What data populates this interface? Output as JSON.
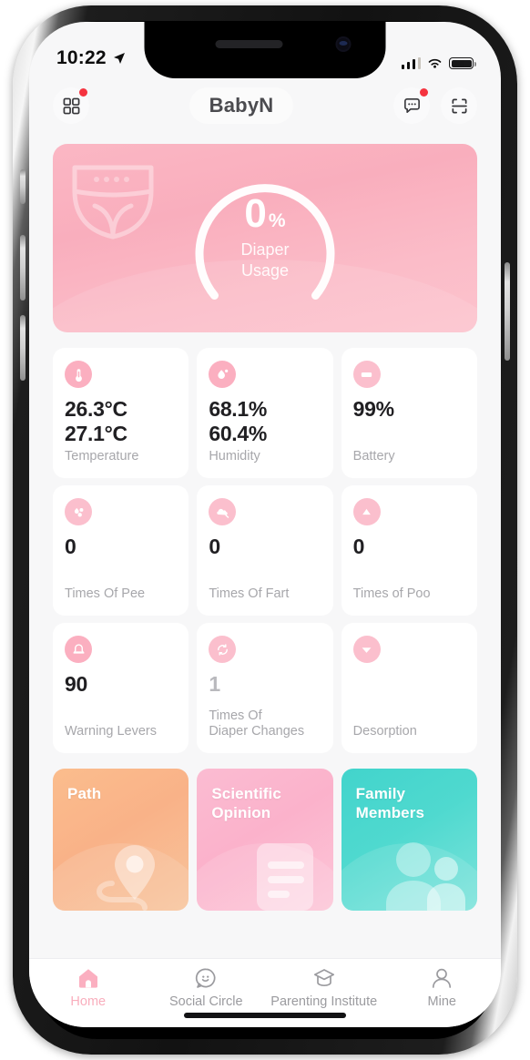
{
  "status_bar": {
    "time": "10:22",
    "location_icon": "location-arrow-icon",
    "signal_icon": "cellular-signal-icon",
    "wifi_icon": "wifi-icon",
    "battery_icon": "battery-full-icon"
  },
  "header": {
    "grid_button": "grid-menu-icon",
    "title": "BabyN",
    "chat_button": "chat-bubble-icon",
    "scan_button": "scan-frame-icon",
    "has_grid_badge": true,
    "has_chat_badge": true
  },
  "hero": {
    "watermark_icon": "diaper-icon",
    "value": "0",
    "unit": "%",
    "label_line1": "Diaper",
    "label_line2": "Usage",
    "gauge_percent": 0,
    "accent": "#f9aebd"
  },
  "metrics": [
    {
      "icon": "thermometer-icon",
      "value": "26.3°C\n27.1°C",
      "value_line1": "26.3°C",
      "value_line2": "27.1°C",
      "label": "Temperature",
      "muted": false
    },
    {
      "icon": "humidity-drop-icon",
      "value": "68.1%\n60.4%",
      "value_line1": "68.1%",
      "value_line2": "60.4%",
      "label": "Humidity",
      "muted": false
    },
    {
      "icon": "battery-icon",
      "value": "99%",
      "value_line1": "99%",
      "value_line2": "",
      "label": "Battery",
      "muted": false
    },
    {
      "icon": "pee-drops-icon",
      "value": "0",
      "value_line1": "0",
      "value_line2": "",
      "label": "Times Of Pee",
      "muted": false
    },
    {
      "icon": "fart-cloud-icon",
      "value": "0",
      "value_line1": "0",
      "value_line2": "",
      "label": "Times Of Fart",
      "muted": false
    },
    {
      "icon": "poo-icon",
      "value": "0",
      "value_line1": "0",
      "value_line2": "",
      "label": "Times of Poo",
      "muted": false
    },
    {
      "icon": "bell-alert-icon",
      "value": "90",
      "value_line1": "90",
      "value_line2": "",
      "label": "Warning Levers",
      "muted": false
    },
    {
      "icon": "diaper-change-icon",
      "value": "1",
      "value_line1": "1",
      "value_line2": "",
      "label": "Times Of\nDiaper Changes",
      "label_line1": "Times Of",
      "label_line2": "Diaper Changes",
      "muted": true
    },
    {
      "icon": "desorption-icon",
      "value": "",
      "value_line1": "",
      "value_line2": "",
      "label": "Desorption",
      "muted": false
    }
  ],
  "features": [
    {
      "title": "Path",
      "title_line1": "Path",
      "title_line2": "",
      "art": "map-pin-icon",
      "color": "#f9b288"
    },
    {
      "title": "Scientific Opinion",
      "title_line1": "Scientific",
      "title_line2": "Opinion",
      "art": "document-icon",
      "color": "#fbb2cb"
    },
    {
      "title": "Family Members",
      "title_line1": "Family",
      "title_line2": "Members",
      "art": "people-icon",
      "color": "#4fd9cf"
    }
  ],
  "tabs": [
    {
      "label": "Home",
      "icon": "home-icon",
      "active": true
    },
    {
      "label": "Social Circle",
      "icon": "smiley-chat-icon",
      "active": false
    },
    {
      "label": "Parenting Institute",
      "icon": "graduation-cap-icon",
      "active": false
    },
    {
      "label": "Mine",
      "icon": "person-icon",
      "active": false
    }
  ]
}
